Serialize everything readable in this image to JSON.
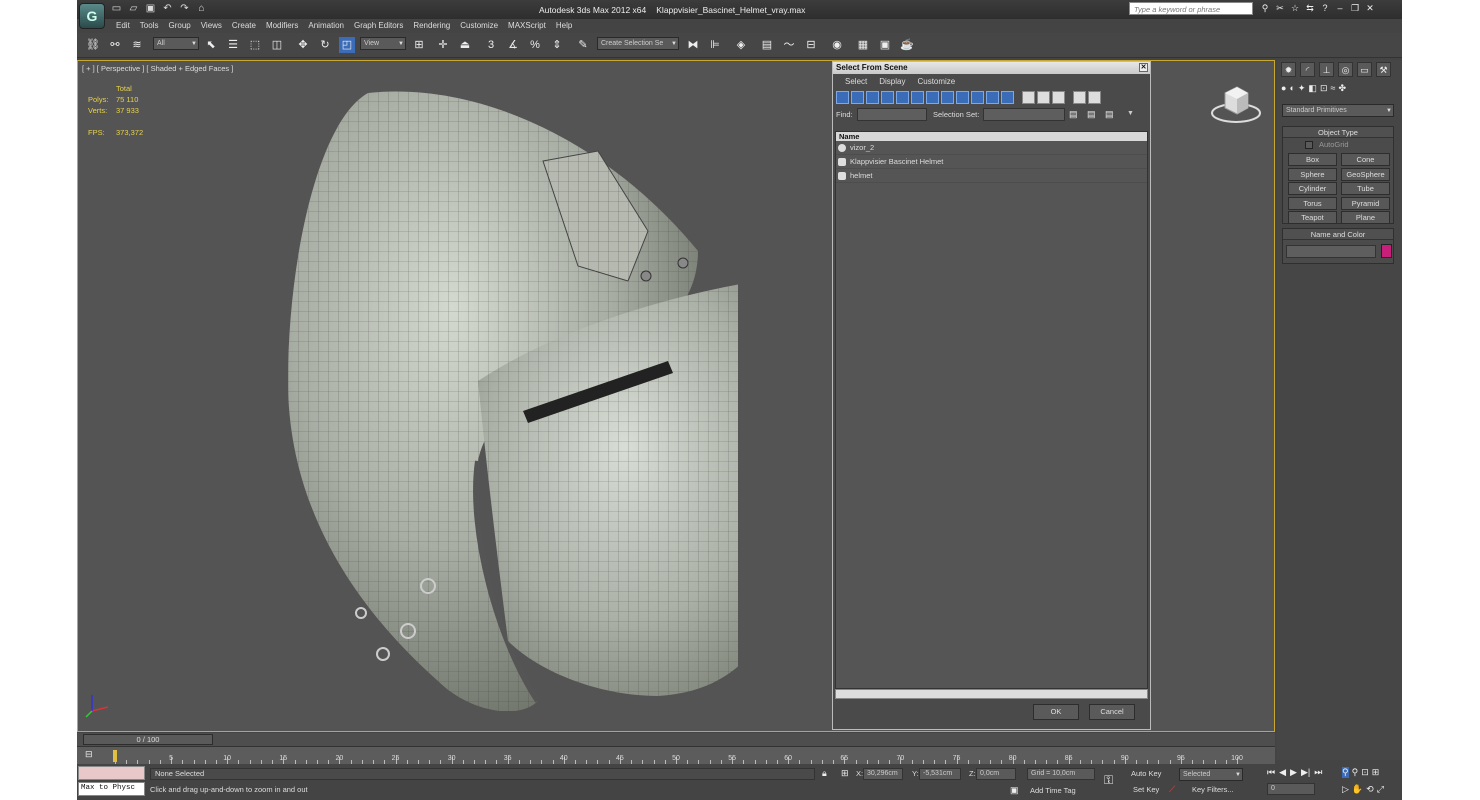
{
  "app": {
    "title": "Autodesk 3ds Max  2012 x64",
    "filename": "Klappvisier_Bascinet_Helmet_vray.max",
    "search_placeholder": "Type a keyword or phrase"
  },
  "menu": [
    "Edit",
    "Tools",
    "Group",
    "Views",
    "Create",
    "Modifiers",
    "Animation",
    "Graph Editors",
    "Rendering",
    "Customize",
    "MAXScript",
    "Help"
  ],
  "toolbar": {
    "filter": "All",
    "ref_coord": "View",
    "selection_set": "Create Selection Se"
  },
  "viewport": {
    "label": "[ + ] [ Perspective ] [ Shaded + Edged Faces ]",
    "stats_header": "Total",
    "polys_label": "Polys:",
    "polys": "75 110",
    "verts_label": "Verts:",
    "verts": "37 933",
    "fps_label": "FPS:",
    "fps": "373,372"
  },
  "dialog": {
    "title": "Select From Scene",
    "menu": [
      "Select",
      "Display",
      "Customize"
    ],
    "find_label": "Find:",
    "selset_label": "Selection Set:",
    "column": "Name",
    "items": [
      "vizor_2",
      "Klappvisier Bascinet Helmet",
      "helmet"
    ],
    "ok": "OK",
    "cancel": "Cancel"
  },
  "cmd": {
    "category": "Standard Primitives",
    "object_type": "Object Type",
    "autogrid": "AutoGrid",
    "primitives": [
      "Box",
      "Cone",
      "Sphere",
      "GeoSphere",
      "Cylinder",
      "Tube",
      "Torus",
      "Pyramid",
      "Teapot",
      "Plane"
    ],
    "name_color": "Name and Color",
    "swatch": "#c8207a"
  },
  "timeline": {
    "frame": "0 / 100",
    "ticks": [
      "0",
      "5",
      "10",
      "15",
      "20",
      "25",
      "30",
      "35",
      "40",
      "45",
      "50",
      "55",
      "60",
      "65",
      "70",
      "75",
      "80",
      "85",
      "90",
      "95",
      "100"
    ]
  },
  "status": {
    "maxscript": "Max to Physc",
    "selection": "None Selected",
    "prompt": "Click and drag up-and-down to zoom in and out",
    "x_label": "X:",
    "x": "30,296cm",
    "y_label": "Y:",
    "y": "-5,531cm",
    "z_label": "Z:",
    "z": "0,0cm",
    "grid": "Grid = 10,0cm",
    "add_time_tag": "Add Time Tag",
    "auto_key": "Auto Key",
    "set_key": "Set Key",
    "key_mode": "Selected",
    "key_filters": "Key Filters...",
    "frame_field": "0"
  }
}
